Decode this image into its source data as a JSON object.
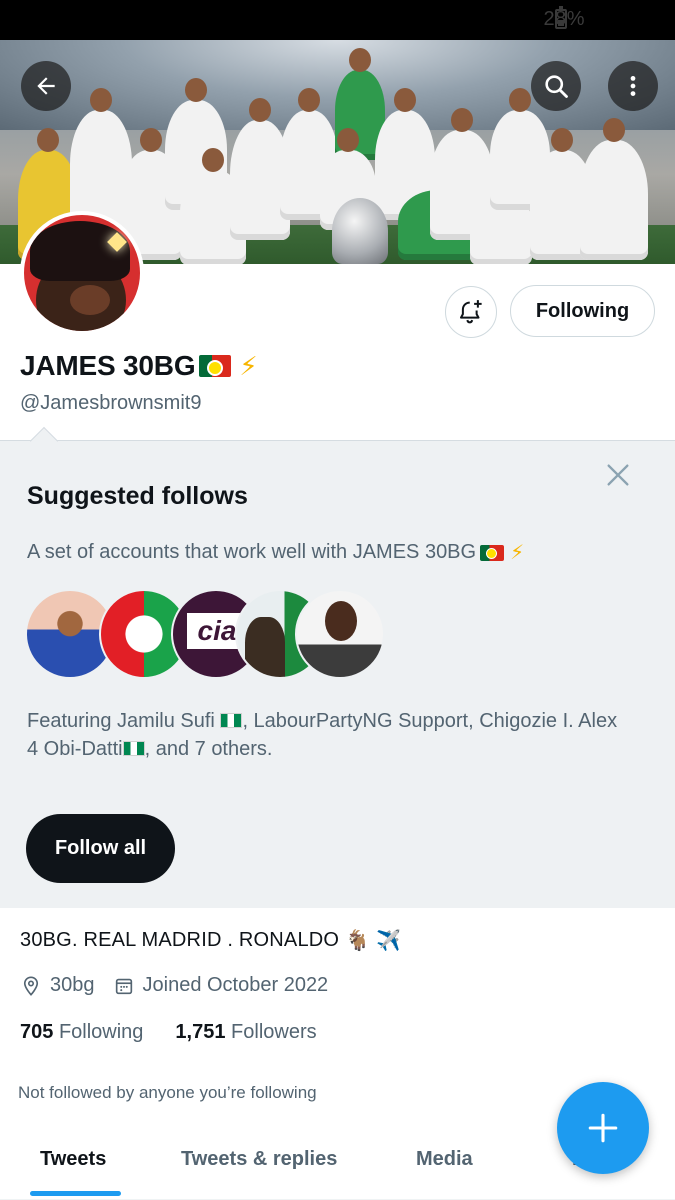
{
  "status_bar": {
    "battery": "28%"
  },
  "profile": {
    "display_name": "JAMES 30BG",
    "handle": "@Jamesbrownsmit9",
    "bio": "30BG. REAL MADRID . RONALDO",
    "location": "30bg",
    "joined": "Joined October 2022",
    "following_count": "705",
    "following_label": "Following",
    "followers_count": "1,751",
    "followers_label": "Followers",
    "not_followed_text": "Not followed by anyone you’re following"
  },
  "actions": {
    "following_button": "Following"
  },
  "suggested_follows": {
    "title": "Suggested follows",
    "description": "A set of accounts that work well with JAMES 30BG",
    "featuring_prefix": "Featuring Jamilu Sufi",
    "featuring_mid": ", LabourPartyNG Support, Chigozie I. Alex 4 Obi-Datti",
    "featuring_suffix": ", and 7 others.",
    "follow_all_button": "Follow all",
    "avatar_texts": {
      "cia": "cia"
    }
  },
  "tabs": [
    {
      "label": "Tweets"
    },
    {
      "label": "Tweets & replies"
    },
    {
      "label": "Media"
    },
    {
      "label": "L"
    }
  ],
  "colors": {
    "accent": "#1d9bf0",
    "text": "#0f1419",
    "muted": "#536471",
    "suggest_bg": "#eef1f3"
  },
  "icons": [
    "back-arrow-icon",
    "search-icon",
    "more-vertical-icon",
    "bell-plus-icon",
    "close-icon",
    "location-pin-icon",
    "calendar-icon",
    "plus-icon"
  ]
}
